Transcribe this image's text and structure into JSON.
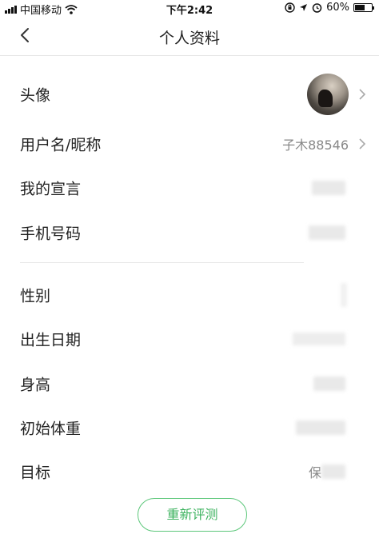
{
  "status_bar": {
    "carrier": "中国移动",
    "time": "下午2:42",
    "battery": "60%",
    "battery_level": 0.6
  },
  "header": {
    "title": "个人资料"
  },
  "profile": {
    "avatar_label": "头像",
    "username_label": "用户名/昵称",
    "username_value": "子木88546",
    "motto_label": "我的宣言",
    "phone_label": "手机号码",
    "gender_label": "性别",
    "birthday_label": "出生日期",
    "height_label": "身高",
    "initial_weight_label": "初始体重",
    "goal_label": "目标",
    "goal_value_prefix": "保"
  },
  "actions": {
    "reevaluate_label": "重新评测"
  }
}
